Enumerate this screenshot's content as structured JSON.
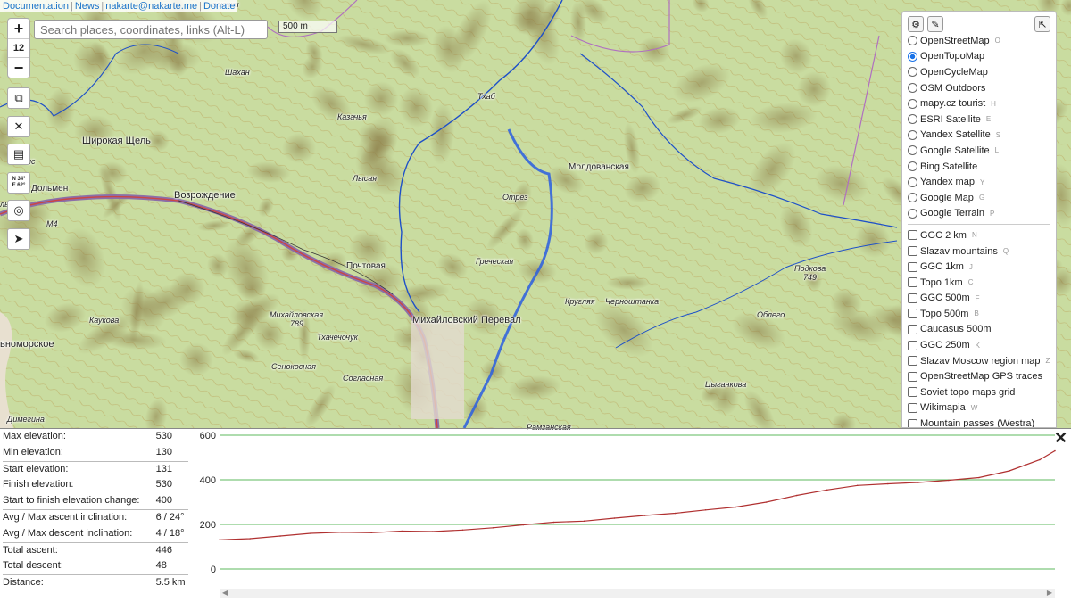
{
  "top_links": [
    "Documentation",
    "News",
    "nakarte@nakarte.me",
    "Donate"
  ],
  "zoom": {
    "plus": "+",
    "level": "12",
    "minus": "−"
  },
  "search": {
    "placeholder": "Search places, coordinates, links (Alt-L)"
  },
  "scale_label": "500 m",
  "coord_button": {
    "line1": "N 34°",
    "line2": "E 62°"
  },
  "map_labels": [
    {
      "text": "Шахан",
      "cls": "small",
      "cls2": ""
    },
    {
      "text": "Тхаб",
      "cls": "small",
      "cls2": ""
    },
    {
      "text": "Казачья",
      "cls": "small",
      "cls2": ""
    },
    {
      "text": "Широкая Щель",
      "cls": "big",
      "cls2": ""
    },
    {
      "text": "Возрождение",
      "cls": "big",
      "cls2": ""
    },
    {
      "text": "Дольмен",
      "cls": "mid",
      "cls2": ""
    },
    {
      "text": "Лысая",
      "cls": "small",
      "cls2": ""
    },
    {
      "text": "Отрез",
      "cls": "small",
      "cls2": ""
    },
    {
      "text": "Молдованская",
      "cls": "mid",
      "cls2": ""
    },
    {
      "text": "Почтовая",
      "cls": "mid",
      "cls2": ""
    },
    {
      "text": "Греческая",
      "cls": "small",
      "cls2": ""
    },
    {
      "text": "Подкова",
      "cls": "small",
      "cls2": ""
    },
    {
      "text": "749",
      "cls": "small",
      "cls2": ""
    },
    {
      "text": "Кругляя",
      "cls": "small",
      "cls2": ""
    },
    {
      "text": "Черноштанка",
      "cls": "small",
      "cls2": ""
    },
    {
      "text": "Облего",
      "cls": "small",
      "cls2": ""
    },
    {
      "text": "Каукова",
      "cls": "small",
      "cls2": ""
    },
    {
      "text": "Михайловская",
      "cls": "small",
      "cls2": ""
    },
    {
      "text": "789",
      "cls": "small",
      "cls2": ""
    },
    {
      "text": "Тхачечочук",
      "cls": "small",
      "cls2": ""
    },
    {
      "text": "Михайловский Перевал",
      "cls": "big",
      "cls2": ""
    },
    {
      "text": "Сенокосная",
      "cls": "small",
      "cls2": ""
    },
    {
      "text": "Согласная",
      "cls": "small",
      "cls2": ""
    },
    {
      "text": "Цыганкова",
      "cls": "small",
      "cls2": ""
    },
    {
      "text": "Рамзанская",
      "cls": "small",
      "cls2": ""
    },
    {
      "text": "Димегина",
      "cls": "small",
      "cls2": ""
    },
    {
      "text": "вноморское",
      "cls": "big",
      "cls2": ""
    },
    {
      "text": "элючки",
      "cls": "small",
      "cls2": ""
    },
    {
      "text": "лый",
      "cls": "small",
      "cls2": ""
    },
    {
      "text": "ис",
      "cls": "small",
      "cls2": ""
    },
    {
      "text": "M4",
      "cls": "small",
      "cls2": ""
    }
  ],
  "layers": {
    "base": [
      {
        "name": "OpenStreetMap",
        "key": "O",
        "selected": false
      },
      {
        "name": "OpenTopoMap",
        "key": "",
        "selected": true
      },
      {
        "name": "OpenCycleMap",
        "key": "",
        "selected": false
      },
      {
        "name": "OSM Outdoors",
        "key": "",
        "selected": false
      },
      {
        "name": "mapy.cz tourist",
        "key": "H",
        "selected": false
      },
      {
        "name": "ESRI Satellite",
        "key": "E",
        "selected": false
      },
      {
        "name": "Yandex Satellite",
        "key": "S",
        "selected": false
      },
      {
        "name": "Google Satellite",
        "key": "L",
        "selected": false
      },
      {
        "name": "Bing Satellite",
        "key": "I",
        "selected": false
      },
      {
        "name": "Yandex map",
        "key": "Y",
        "selected": false
      },
      {
        "name": "Google Map",
        "key": "G",
        "selected": false
      },
      {
        "name": "Google Terrain",
        "key": "P",
        "selected": false
      }
    ],
    "overlays": [
      {
        "name": "GGC 2 km",
        "key": "N"
      },
      {
        "name": "Slazav mountains",
        "key": "Q"
      },
      {
        "name": "GGC 1km",
        "key": "J"
      },
      {
        "name": "Topo 1km",
        "key": "C"
      },
      {
        "name": "GGC 500m",
        "key": "F"
      },
      {
        "name": "Topo 500m",
        "key": "B"
      },
      {
        "name": "Caucasus 500m",
        "key": ""
      },
      {
        "name": "GGC 250m",
        "key": "K"
      },
      {
        "name": "Slazav Moscow region map",
        "key": "Z"
      },
      {
        "name": "OpenStreetMap GPS traces",
        "key": ""
      },
      {
        "name": "Soviet topo maps grid",
        "key": ""
      },
      {
        "name": "Wikimapia",
        "key": "W"
      },
      {
        "name": "Mountain passes (Westra)",
        "key": ""
      }
    ]
  },
  "stats": [
    {
      "label": "Max elevation:",
      "value": "530",
      "group": false
    },
    {
      "label": "Min elevation:",
      "value": "130",
      "group": false
    },
    {
      "label": "Start elevation:",
      "value": "131",
      "group": true
    },
    {
      "label": "Finish elevation:",
      "value": "530",
      "group": false
    },
    {
      "label": "Start to finish elevation change:",
      "value": "400",
      "group": false
    },
    {
      "label": "Avg / Max ascent inclination:",
      "value": "6 / 24°",
      "group": true
    },
    {
      "label": "Avg / Max descent inclination:",
      "value": "4 / 18°",
      "group": false
    },
    {
      "label": "Total ascent:",
      "value": "446",
      "group": true
    },
    {
      "label": "Total descent:",
      "value": "48",
      "group": false
    },
    {
      "label": "Distance:",
      "value": "5.5 km",
      "group": true
    }
  ],
  "close_symbol": "✕",
  "chart_data": {
    "type": "line",
    "title": "",
    "xlabel": "",
    "ylabel": "",
    "ylim": [
      0,
      600
    ],
    "yticks": [
      0,
      200,
      400,
      600
    ],
    "xlim": [
      0,
      5.5
    ],
    "grid": true,
    "line_color": "#b03030",
    "grid_color": "#5cb85c",
    "series": [
      {
        "x": [
          0,
          0.2,
          0.4,
          0.6,
          0.8,
          1.0,
          1.2,
          1.4,
          1.6,
          1.8,
          2.0,
          2.2,
          2.4,
          2.6,
          2.8,
          3.0,
          3.2,
          3.4,
          3.6,
          3.8,
          4.0,
          4.2,
          4.4,
          4.6,
          4.8,
          5.0,
          5.2,
          5.4,
          5.5
        ],
        "y": [
          131,
          136,
          148,
          160,
          165,
          163,
          170,
          168,
          175,
          185,
          198,
          210,
          215,
          228,
          240,
          250,
          265,
          278,
          300,
          330,
          355,
          375,
          382,
          388,
          398,
          410,
          440,
          490,
          530
        ]
      }
    ]
  }
}
